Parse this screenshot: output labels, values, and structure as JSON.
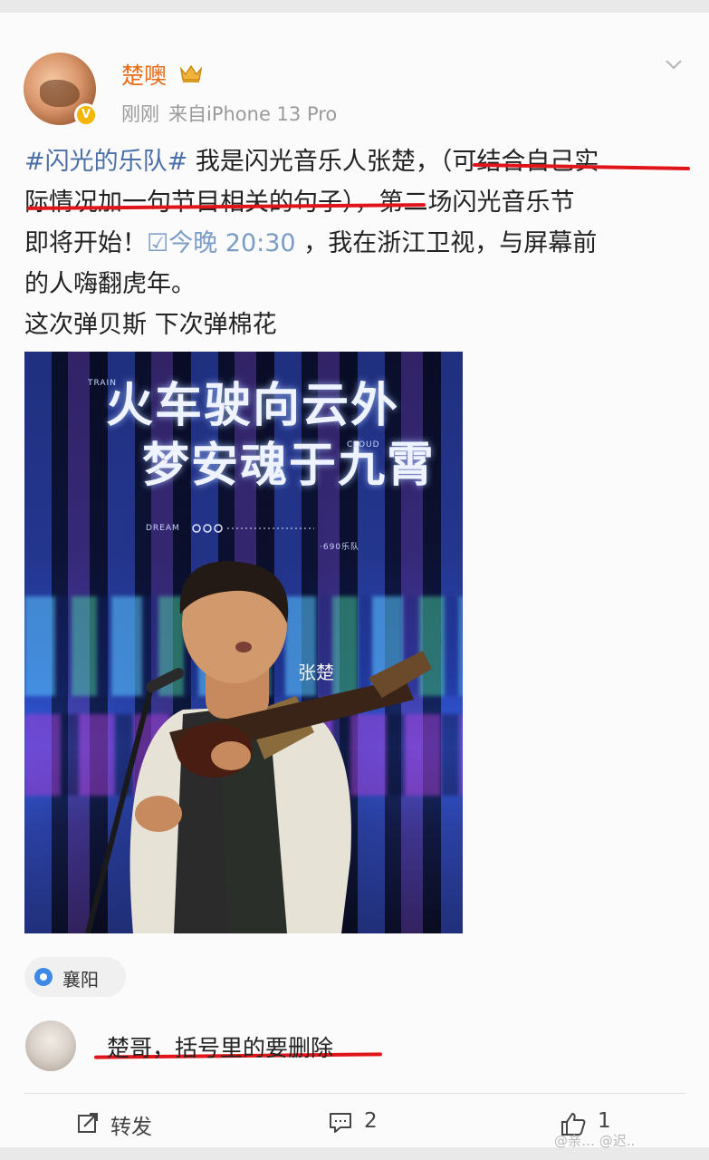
{
  "post": {
    "username": "楚噢",
    "timestamp": "刚刚",
    "source": "来自iPhone 13 Pro",
    "hashtag": "#闪光的乐队#",
    "line1_rest": " 我是闪光音乐人张楚，（可结合自己实",
    "line2": "际情况加一句节目相关的句子），第二场闪光音乐节",
    "line3_a": "即将开始！",
    "time_ref": "☑今晚 20:30",
    "line3_b": " ，我在浙江卫视，与屏幕前",
    "line4": "的人嗨翻虎年。",
    "line5": "这次弹贝斯 下次弹棉花"
  },
  "poster": {
    "title_line1": "火车驶向云外",
    "title_line2": "梦安魂于九霄",
    "small_train": "TRAIN",
    "small_cloud": "CLOUD",
    "small_dream": "DREAM",
    "small_band": "·690乐队",
    "performer": "张楚"
  },
  "location": {
    "label": "襄阳"
  },
  "comment": {
    "text": "楚哥，括号里的要删除"
  },
  "actions": {
    "repost_label": "转发",
    "comment_count": "2",
    "like_count": "1"
  },
  "watermark": "@亲… @迟..",
  "colors": {
    "username": "#e86c17",
    "hashtag": "#4b6fa8",
    "annotation_red": "#e0151a",
    "meta_gray": "#9a9a9a"
  }
}
